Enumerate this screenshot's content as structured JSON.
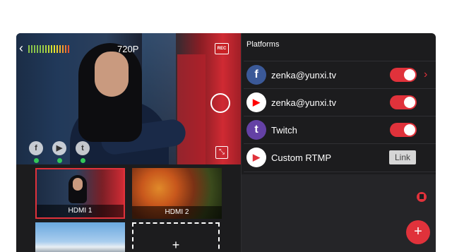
{
  "preview": {
    "resolution": "720P",
    "rec_label": "REC",
    "level_meter_colors": [
      "#8bc34a",
      "#8bc34a",
      "#8bc34a",
      "#8bc34a",
      "#8bc34a",
      "#9ccc4a",
      "#aed43f",
      "#c2dc38",
      "#d6e231",
      "#e6e42b",
      "#f2d02a",
      "#f5b72b",
      "#f39a2c",
      "#ee7a2e",
      "#e75a30"
    ],
    "platform_badges": [
      {
        "icon": "facebook-icon",
        "glyph": "f"
      },
      {
        "icon": "youtube-icon",
        "glyph": "▶"
      },
      {
        "icon": "twitch-icon",
        "glyph": "t"
      }
    ],
    "badge_status_color": "#34c759"
  },
  "sources": {
    "tile1_label": "HDMI 1",
    "tile2_label": "HDMI 2",
    "add_label": "+"
  },
  "platforms": {
    "title": "Platforms",
    "rows": [
      {
        "icon": "facebook-icon",
        "glyph": "f",
        "color": "#3b5998",
        "label": "zenka@yunxi.tv",
        "enabled": true
      },
      {
        "icon": "youtube-icon",
        "glyph": "▶",
        "color": "#ff0000",
        "label": "zenka@yunxi.tv",
        "enabled": true
      },
      {
        "icon": "twitch-icon",
        "glyph": "t",
        "color": "#6441a5",
        "label": "Twitch",
        "enabled": true
      },
      {
        "icon": "rtmp-icon",
        "glyph": "▶",
        "color": "#e0323b",
        "label": "Custom RTMP",
        "action": "Link"
      }
    ]
  },
  "accent": "#e0323b",
  "fab_label": "+"
}
